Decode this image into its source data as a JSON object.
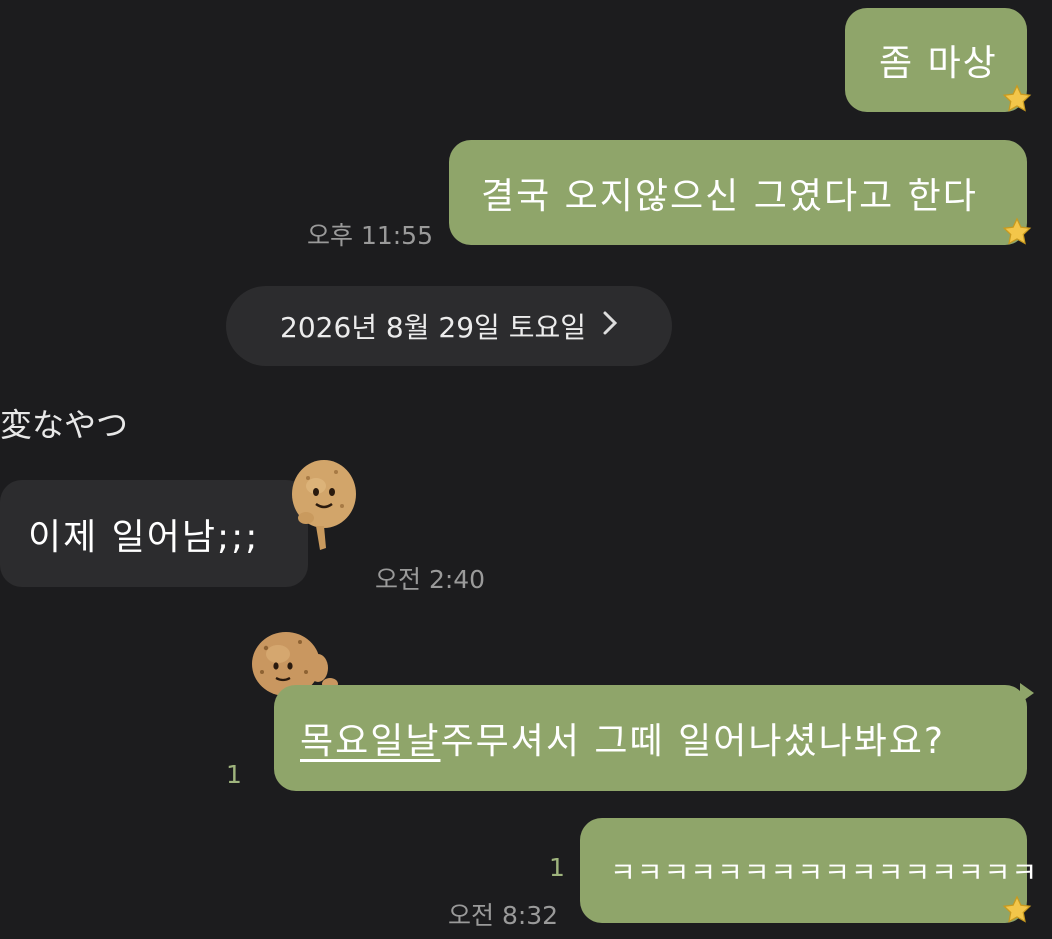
{
  "messages": [
    {
      "id": "m1",
      "direction": "out",
      "text": "좀 마상"
    },
    {
      "id": "m2",
      "direction": "out",
      "text": "결국 오지않으신 그였다고 한다",
      "time": "오후 11:55"
    },
    {
      "id": "m3",
      "direction": "in",
      "sender": "変なやつ",
      "text": "이제 일어남;;;",
      "time": "오전 2:40"
    },
    {
      "id": "m4",
      "direction": "out",
      "text_underlined": "목요일날",
      "text_rest": " 주무셔서 그떼 일어나셨나봐요?",
      "unread": "1"
    },
    {
      "id": "m5",
      "direction": "out",
      "text": "ㅋㅋㅋㅋㅋㅋㅋㅋㅋㅋㅋㅋㅋㅋㅋㅋ",
      "unread": "1",
      "time": "오전 8:32"
    }
  ],
  "date_divider": "2026년 8월 29일 토요일",
  "icons": {
    "reaction": "star-icon",
    "date_arrow": "chevron-right-icon",
    "sticker": "potato-character-sticker"
  },
  "colors": {
    "background": "#1c1c1e",
    "outgoing_bubble": "#8fa56a",
    "incoming_bubble": "#2c2c2e",
    "time_text": "#9a9a9a",
    "unread": "#9fb47d"
  }
}
